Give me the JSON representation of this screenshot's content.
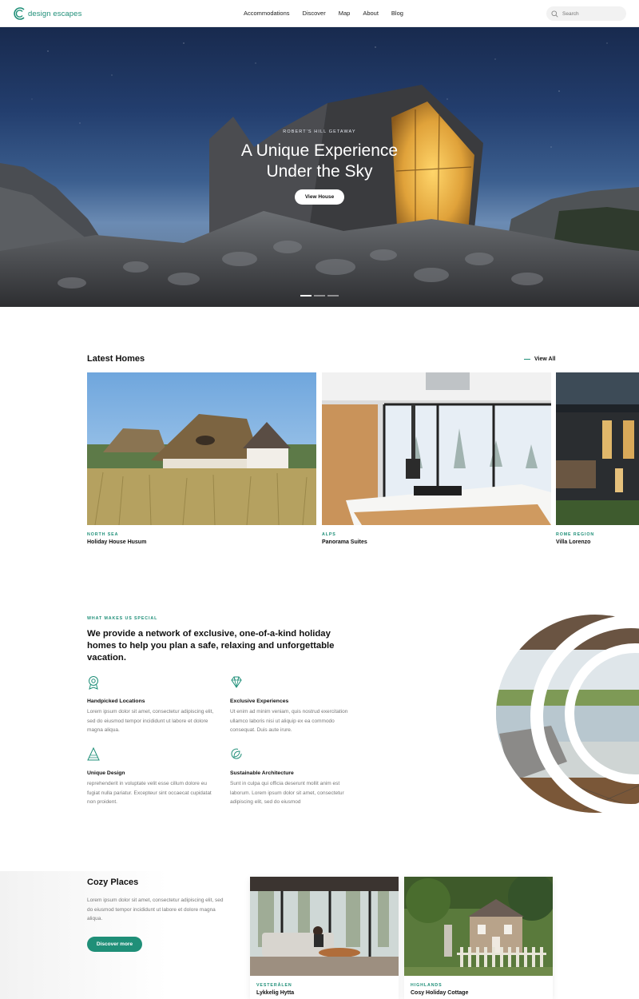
{
  "brand": {
    "name": "design escapes",
    "accent": "#1f8f78"
  },
  "nav": {
    "items": [
      "Accommodations",
      "Discover",
      "Map",
      "About",
      "Blog"
    ],
    "search_placeholder": "Search"
  },
  "hero": {
    "eyebrow": "ROBERT'S HILL GETAWAY",
    "title_line1": "A Unique Experience",
    "title_line2": "Under the Sky",
    "button": "View House",
    "slides": 3,
    "active_slide": 1
  },
  "latest": {
    "title": "Latest Homes",
    "view_all": "View All",
    "cards": [
      {
        "region": "NORTH SEA",
        "name": "Holiday House Husum"
      },
      {
        "region": "ALPS",
        "name": "Panorama Suites"
      },
      {
        "region": "ROME REGION",
        "name": "Villa Lorenzo"
      }
    ]
  },
  "special": {
    "eyebrow": "WHAT MAKES US SPECIAL",
    "heading": "We provide a network of exclusive, one-of-a-kind holiday homes to help you plan a safe, relaxing and unforgettable vacation.",
    "features": [
      {
        "icon": "location-badge-icon",
        "title": "Handpicked Locations",
        "text": "Lorem ipsum dolor sit amet, consectetur adipiscing elit, sed do eiusmod tempor incididunt ut labore et dolore magna aliqua."
      },
      {
        "icon": "diamond-icon",
        "title": "Exclusive Experiences",
        "text": "Ut enim ad minim veniam, quis nostrud exercitation ullamco laboris nisi ut aliquip ex ea commodo consequat. Duis aute irure."
      },
      {
        "icon": "architecture-icon",
        "title": "Unique Design",
        "text": "reprehenderit in voluptate velit esse cillum dolore eu fugiat nulla pariatur. Excepteur sint occaecat cupidatat non proident."
      },
      {
        "icon": "leaf-cycle-icon",
        "title": "Sustainable Architecture",
        "text": "Sunt in culpa qui officia deserunt mollit anim est laborum. Lorem ipsum dolor sit amet, consectetur adipiscing elit, sed do eiusmod"
      }
    ]
  },
  "cozy": {
    "title": "Cozy Places",
    "text": "Lorem ipsum dolor sit amet, consectetur adipiscing elit, sed do eiusmod tempor incididunt ut labore et dolore magna aliqua.",
    "button": "Discover more",
    "cards": [
      {
        "region": "VESTERÅLEN",
        "name": "Lykkelig Hytta"
      },
      {
        "region": "HIGHLANDS",
        "name": "Cosy Holiday Cottage"
      }
    ]
  }
}
